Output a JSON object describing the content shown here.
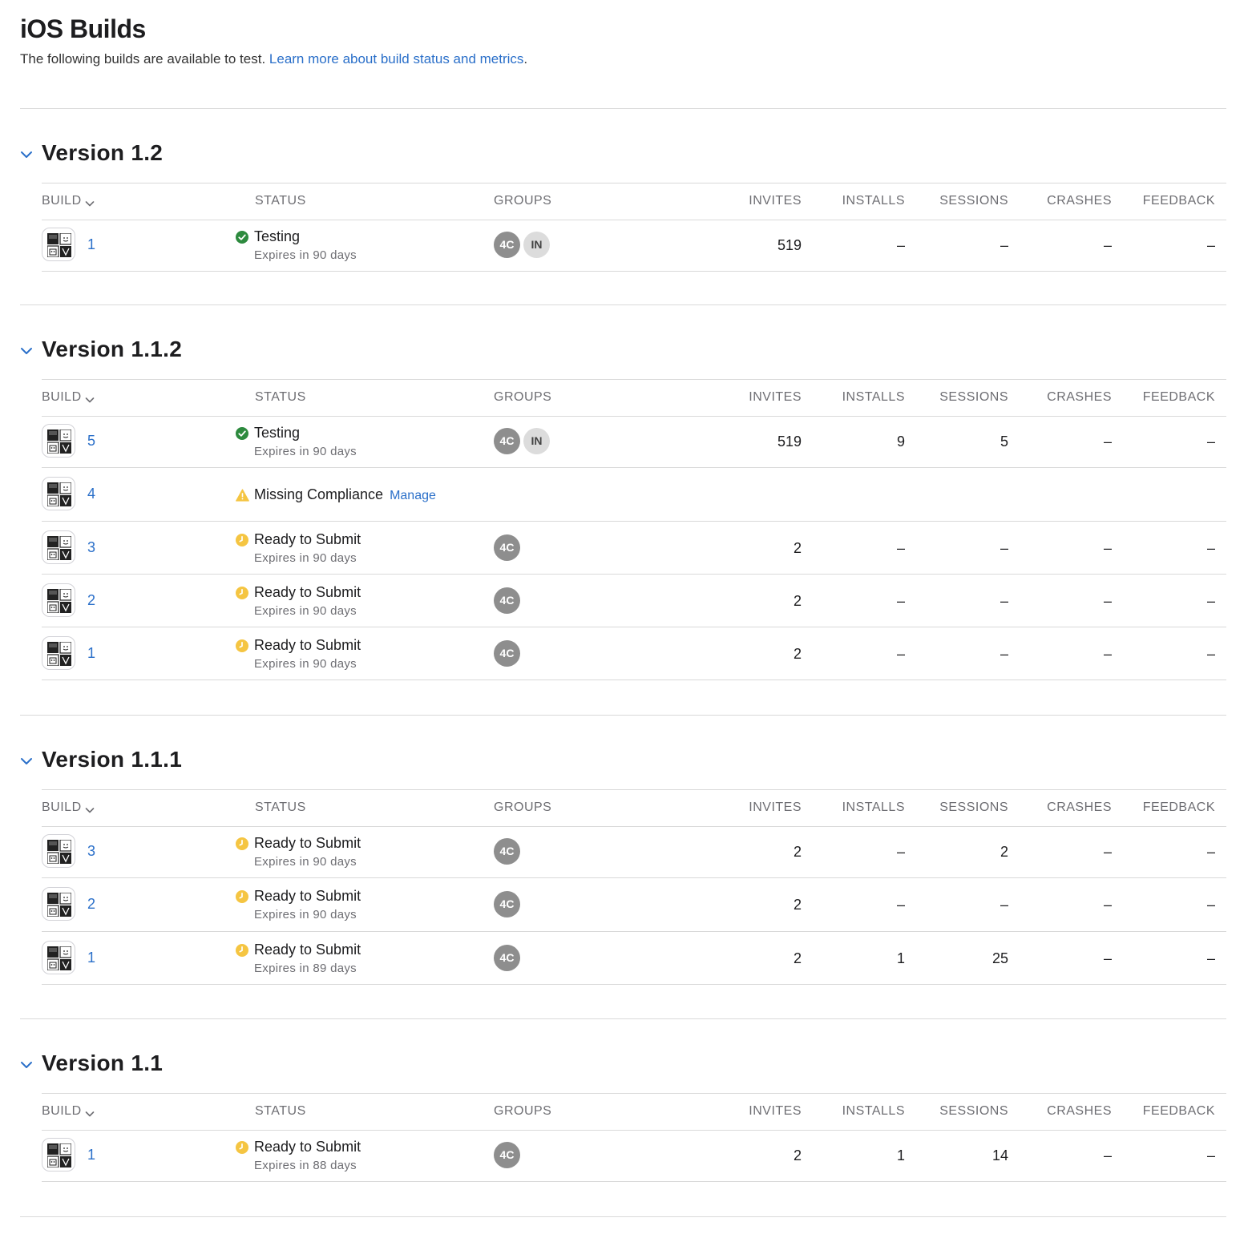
{
  "page": {
    "title": "iOS Builds",
    "intro_text": "The following builds are available to test. ",
    "intro_link": "Learn more about build status and metrics",
    "intro_end": "."
  },
  "columns": {
    "build": "BUILD",
    "status": "STATUS",
    "groups": "GROUPS",
    "invites": "INVITES",
    "installs": "INSTALLS",
    "sessions": "SESSIONS",
    "crashes": "CRASHES",
    "feedback": "FEEDBACK"
  },
  "colors": {
    "link": "#2a6fc9",
    "status_green": "#2d8a3e",
    "status_yellow": "#f5c542",
    "badge_dark": "#8e8e8e",
    "badge_light": "#dcdcdc"
  },
  "versions": [
    {
      "title": "Version 1.2",
      "builds": [
        {
          "build": "1",
          "status_icon": "check-circle-icon",
          "status": "Testing",
          "sub": "Expires in 90 days",
          "groups": [
            "4C",
            "IN"
          ],
          "invites": "519",
          "installs": "–",
          "sessions": "–",
          "crashes": "–",
          "feedback": "–"
        }
      ]
    },
    {
      "title": "Version 1.1.2",
      "builds": [
        {
          "build": "5",
          "status_icon": "check-circle-icon",
          "status": "Testing",
          "sub": "Expires in 90 days",
          "groups": [
            "4C",
            "IN"
          ],
          "invites": "519",
          "installs": "9",
          "sessions": "5",
          "crashes": "–",
          "feedback": "–"
        },
        {
          "build": "4",
          "status_icon": "warning-icon",
          "status": "Missing Compliance",
          "action": "Manage",
          "sub": "",
          "groups": [],
          "invites": "",
          "installs": "",
          "sessions": "",
          "crashes": "",
          "feedback": ""
        },
        {
          "build": "3",
          "status_icon": "clock-icon",
          "status": "Ready to Submit",
          "sub": "Expires in 90 days",
          "groups": [
            "4C"
          ],
          "invites": "2",
          "installs": "–",
          "sessions": "–",
          "crashes": "–",
          "feedback": "–"
        },
        {
          "build": "2",
          "status_icon": "clock-icon",
          "status": "Ready to Submit",
          "sub": "Expires in 90 days",
          "groups": [
            "4C"
          ],
          "invites": "2",
          "installs": "–",
          "sessions": "–",
          "crashes": "–",
          "feedback": "–"
        },
        {
          "build": "1",
          "status_icon": "clock-icon",
          "status": "Ready to Submit",
          "sub": "Expires in 90 days",
          "groups": [
            "4C"
          ],
          "invites": "2",
          "installs": "–",
          "sessions": "–",
          "crashes": "–",
          "feedback": "–"
        }
      ]
    },
    {
      "title": "Version 1.1.1",
      "builds": [
        {
          "build": "3",
          "status_icon": "clock-icon",
          "status": "Ready to Submit",
          "sub": "Expires in 90 days",
          "groups": [
            "4C"
          ],
          "invites": "2",
          "installs": "–",
          "sessions": "2",
          "crashes": "–",
          "feedback": "–"
        },
        {
          "build": "2",
          "status_icon": "clock-icon",
          "status": "Ready to Submit",
          "sub": "Expires in 90 days",
          "groups": [
            "4C"
          ],
          "invites": "2",
          "installs": "–",
          "sessions": "–",
          "crashes": "–",
          "feedback": "–"
        },
        {
          "build": "1",
          "status_icon": "clock-icon",
          "status": "Ready to Submit",
          "sub": "Expires in 89 days",
          "groups": [
            "4C"
          ],
          "invites": "2",
          "installs": "1",
          "sessions": "25",
          "crashes": "–",
          "feedback": "–"
        }
      ]
    },
    {
      "title": "Version 1.1",
      "builds": [
        {
          "build": "1",
          "status_icon": "clock-icon",
          "status": "Ready to Submit",
          "sub": "Expires in 88 days",
          "groups": [
            "4C"
          ],
          "invites": "2",
          "installs": "1",
          "sessions": "14",
          "crashes": "–",
          "feedback": "–"
        }
      ]
    }
  ]
}
